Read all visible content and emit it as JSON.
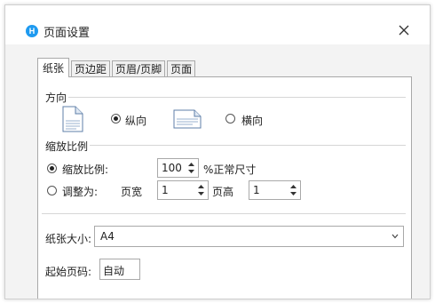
{
  "window": {
    "title": "页面设置",
    "app_icon_letter": "H"
  },
  "tabs": [
    {
      "label": "纸张",
      "active": true
    },
    {
      "label": "页边距",
      "active": false
    },
    {
      "label": "页眉/页脚",
      "active": false
    },
    {
      "label": "页面",
      "active": false
    }
  ],
  "orientation": {
    "label": "方向",
    "portrait_label": "纵向",
    "landscape_label": "横向",
    "selected": "portrait"
  },
  "scaling": {
    "label": "缩放比例",
    "scale_option_label": "缩放比例:",
    "scale_value": "100",
    "scale_suffix": "%正常尺寸",
    "fit_option_label": "调整为:",
    "pages_wide_label": "页宽",
    "pages_wide_value": "1",
    "pages_tall_label": "页高",
    "pages_tall_value": "1",
    "selected": "scale"
  },
  "paper_size": {
    "label": "纸张大小:",
    "value": "A4"
  },
  "first_page_number": {
    "label": "起始页码:",
    "value": "自动"
  },
  "colors": {
    "accent": "#1e9af0",
    "dialog_bg": "#f3f3f3",
    "border": "#a9a9a9"
  }
}
